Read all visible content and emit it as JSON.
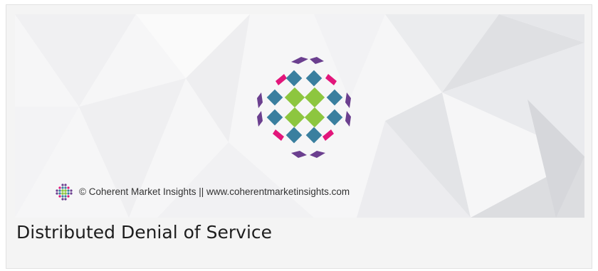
{
  "hero": {
    "logo_icon": "coherent-market-insights-logo-icon",
    "credit_icon": "coherent-market-insights-small-logo-icon",
    "credit_text": "© Coherent Market Insights || www.coherentmarketinsights.com"
  },
  "card": {
    "title": "Distributed Denial of Service"
  },
  "colors": {
    "purple": "#6b3f8f",
    "magenta": "#e2167b",
    "teal": "#3a7f9f",
    "green": "#8dc63f",
    "title_text": "#1e1e1e",
    "card_bg": "#f4f4f4"
  }
}
